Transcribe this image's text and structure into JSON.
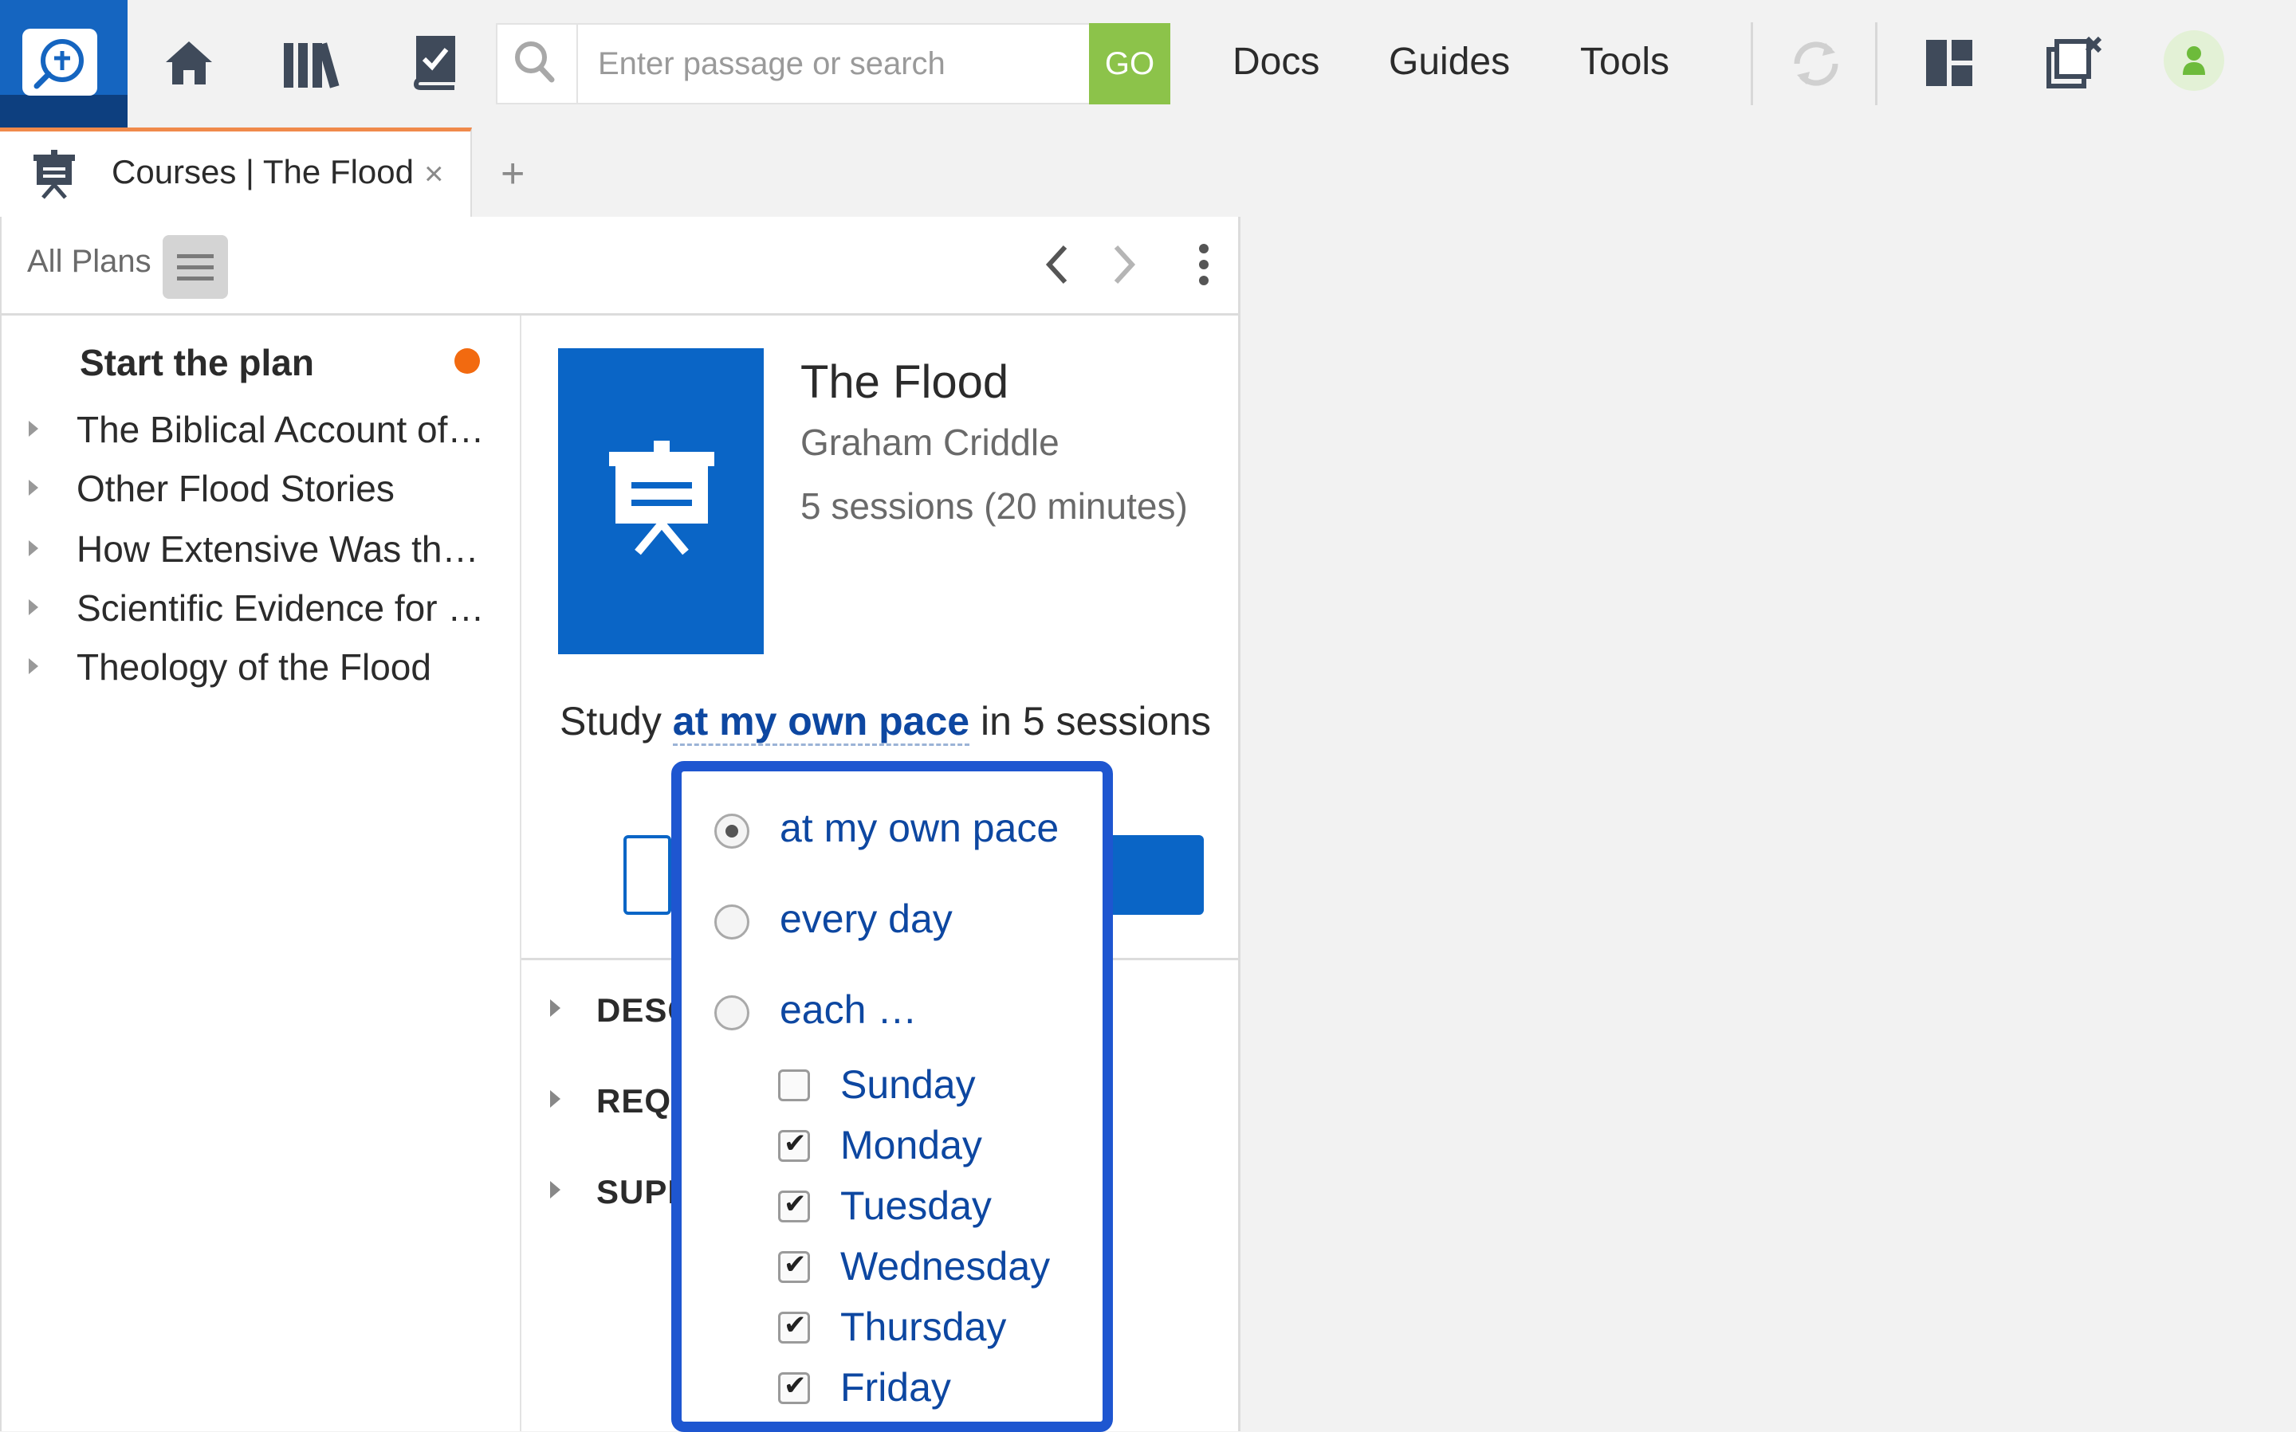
{
  "search": {
    "placeholder": "Enter passage or search",
    "go_label": "GO"
  },
  "nav": {
    "docs": "Docs",
    "guides": "Guides",
    "tools": "Tools"
  },
  "tab": {
    "title": "Courses | The Flood",
    "close": "×",
    "add": "+"
  },
  "toolbar": {
    "all_plans": "All Plans"
  },
  "sidebar": {
    "start_label": "Start the plan",
    "status_color": "#f26a10",
    "sessions": [
      "The Biblical Account of…",
      "Other Flood Stories",
      "How Extensive Was the…",
      "Scientific Evidence for …",
      "Theology of the Flood"
    ]
  },
  "course": {
    "title": "The Flood",
    "author": "Graham Criddle",
    "length": "5 sessions (20 minutes)",
    "cover_color": "#0a65c6"
  },
  "study": {
    "prefix": "Study",
    "pace": "at my own pace",
    "suffix": "in 5 sessions"
  },
  "sections": [
    "DESC",
    "REQU",
    "SUPI"
  ],
  "schedule_popup": {
    "options": [
      {
        "label": "at my own pace",
        "selected": true
      },
      {
        "label": "every day",
        "selected": false
      },
      {
        "label": "each …",
        "selected": false
      }
    ],
    "days": [
      {
        "label": "Sunday",
        "checked": false
      },
      {
        "label": "Monday",
        "checked": true
      },
      {
        "label": "Tuesday",
        "checked": true
      },
      {
        "label": "Wednesday",
        "checked": true
      },
      {
        "label": "Thursday",
        "checked": true
      },
      {
        "label": "Friday",
        "checked": true
      }
    ]
  },
  "colors": {
    "accent": "#1565c0",
    "go": "#8cc34a",
    "tab_accent": "#f08a4b",
    "popup_border": "#1e56d0"
  }
}
